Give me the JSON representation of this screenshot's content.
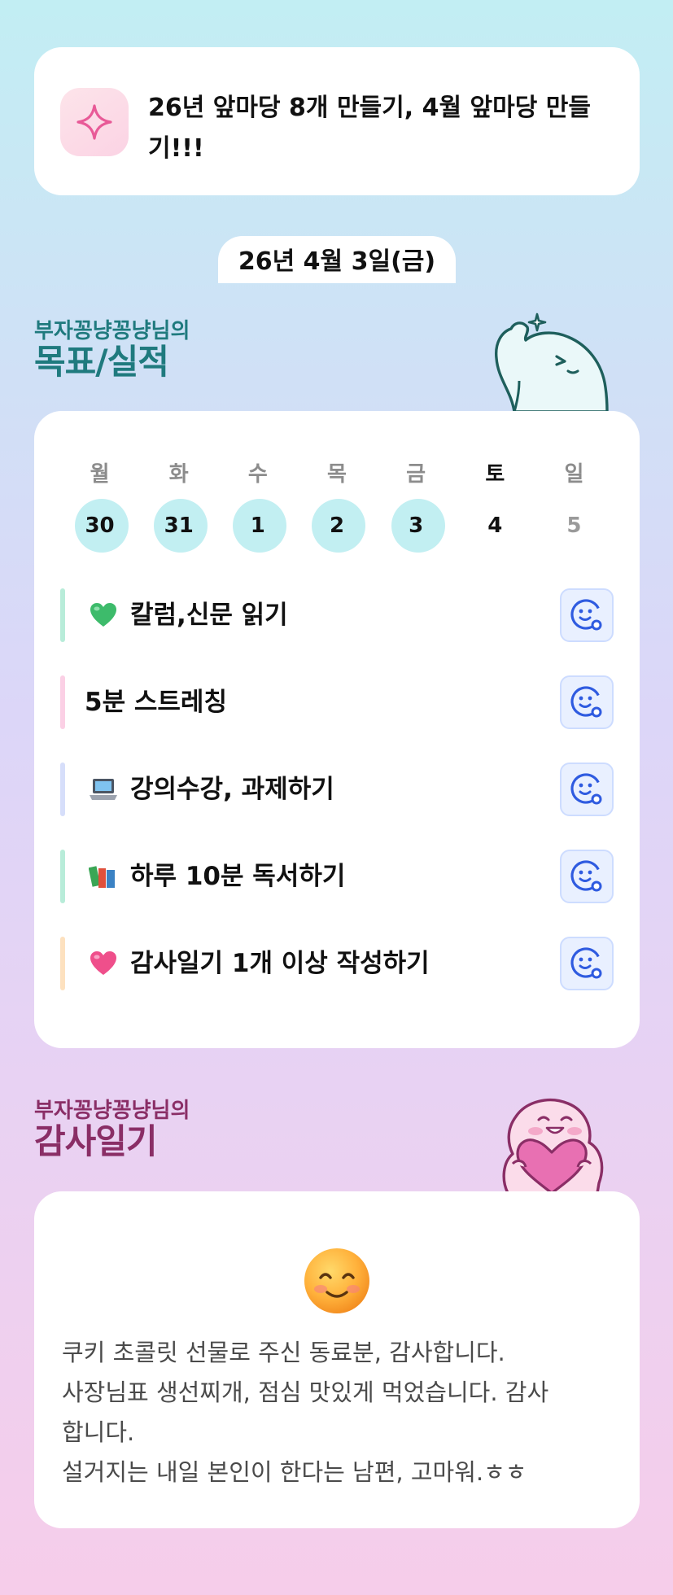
{
  "goal": {
    "icon": "sparkle-icon",
    "text": "26년 앞마당 8개 만들기, 4월 앞마당 만들기!!!"
  },
  "date_pill": "26년 4월 3일(금)",
  "goals_section": {
    "subtitle": "부자꽁냥꽁냥님의",
    "title": "목표/실적",
    "mascot": "ghost-mascot"
  },
  "week": {
    "days": [
      {
        "weekday": "월",
        "date": "30",
        "state": "done"
      },
      {
        "weekday": "화",
        "date": "31",
        "state": "done"
      },
      {
        "weekday": "수",
        "date": "1",
        "state": "done"
      },
      {
        "weekday": "목",
        "date": "2",
        "state": "done"
      },
      {
        "weekday": "금",
        "date": "3",
        "state": "done"
      },
      {
        "weekday": "토",
        "date": "4",
        "state": "today"
      },
      {
        "weekday": "일",
        "date": "5",
        "state": "future"
      }
    ]
  },
  "tasks": [
    {
      "emoji": "green-heart-icon",
      "label": "칼럼,신문 읽기",
      "bar_color": "#b8ecd9"
    },
    {
      "emoji": "",
      "label": "5분 스트레칭",
      "bar_color": "#fbd0e5"
    },
    {
      "emoji": "laptop-icon",
      "label": "강의수강, 과제하기",
      "bar_color": "#d6defa"
    },
    {
      "emoji": "books-icon",
      "label": "하루 10분 독서하기",
      "bar_color": "#b8ecd9"
    },
    {
      "emoji": "pink-heart-icon",
      "label": "감사일기 1개 이상 작성하기",
      "bar_color": "#fde1bf"
    }
  ],
  "thanks_section": {
    "subtitle": "부자꽁냥꽁냥님의",
    "title": "감사일기",
    "mascot": "heart-mascot",
    "emoji": "smiling-face-icon",
    "lines": [
      "쿠키 초콜릿 선물로 주신 동료분, 감사합니다.",
      "사장님표 생선찌개, 점심 맛있게 먹었습니다. 감사",
      "합니다.",
      "설거지는 내일 본인이 한다는 남편, 고마워.ㅎㅎ"
    ]
  },
  "colors": {
    "accent_teal": "#1f7a7e",
    "accent_plum": "#8a2e66",
    "done_circle": "#c2eff2",
    "check_button": "#e9f0ff",
    "check_icon": "#2f5be0"
  }
}
